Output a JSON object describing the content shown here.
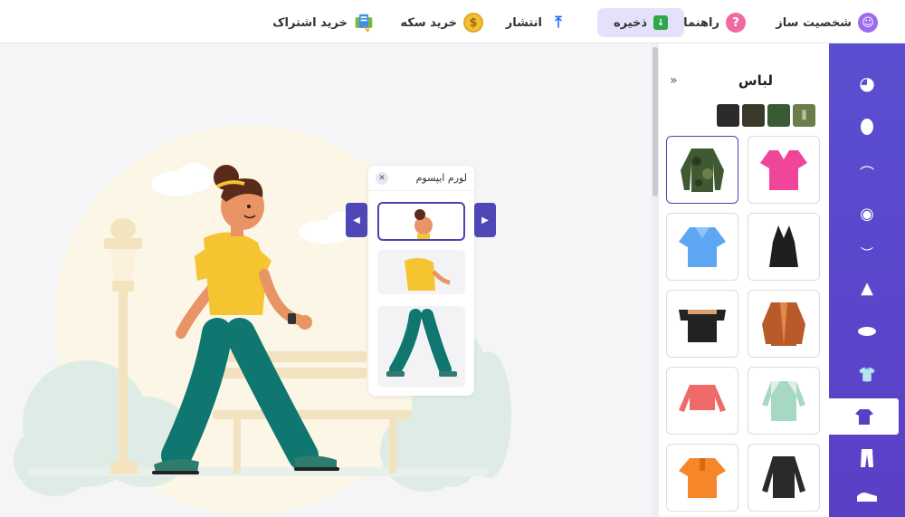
{
  "topbar": {
    "builder_label": "شخصیت ساز",
    "help_label": "راهنما",
    "save_label": "ذخیره",
    "publish_label": "انتشار",
    "coins_label": "خرید سکه",
    "subscription_label": "خرید اشتراک"
  },
  "panel": {
    "title": "لباس",
    "collapse_icon": "double-chevron-right-icon",
    "swatches": [
      "#2b2b2b",
      "#3b3a2a",
      "#3a5a36",
      "#6b7d4a"
    ],
    "items": [
      {
        "name": "camo-long-sleeve-shirt",
        "color": "#3f5a33",
        "selected": true
      },
      {
        "name": "pink-v-neck-top",
        "color": "#f0469a",
        "selected": false
      },
      {
        "name": "blue-collar-top",
        "color": "#5ca6f2",
        "selected": false
      },
      {
        "name": "black-halter-top",
        "color": "#1f1f1f",
        "selected": false
      },
      {
        "name": "black-off-shoulder-top",
        "color": "#222222",
        "selected": false
      },
      {
        "name": "brown-cardigan",
        "color": "#b85a2a",
        "selected": false
      },
      {
        "name": "coral-crop-long-sleeve",
        "color": "#f06a6a",
        "selected": false
      },
      {
        "name": "mint-raglan-shirt",
        "color": "#a6d8c4",
        "selected": false
      },
      {
        "name": "orange-polo",
        "color": "#f5862a",
        "selected": false
      },
      {
        "name": "black-long-sleeve-tee",
        "color": "#2a2a2a",
        "selected": false
      }
    ]
  },
  "sidebar": {
    "items": [
      "head-icon",
      "face-shape-icon",
      "hair-icon",
      "eye-icon",
      "eyebrow-icon",
      "nose-icon",
      "lips-icon",
      "outfit-icon",
      "shirt-icon",
      "pants-icon",
      "shoe-icon"
    ],
    "active": "shirt-icon"
  },
  "popup": {
    "title": "لورم ایپسوم",
    "parts": [
      "head-part",
      "torso-part",
      "legs-part"
    ]
  },
  "colors": {
    "accent": "#5b4fcf",
    "save_bg": "#e4e1fb"
  }
}
